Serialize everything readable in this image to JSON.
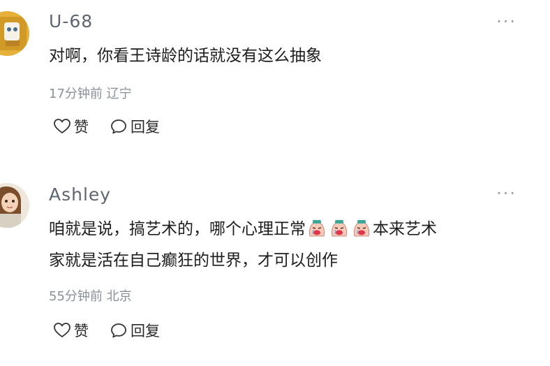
{
  "comments": [
    {
      "username": "U-68",
      "text": "对啊，你看王诗龄的话就没有这么抽象",
      "time": "17分钟前",
      "location": "辽宁",
      "like_label": "赞",
      "reply_label": "回复",
      "more": "···"
    },
    {
      "username": "Ashley",
      "text_part1": "咱就是说，搞艺术的，哪个心理正常",
      "text_part2": "本来艺术",
      "text_line2": "家就是活在自己癫狂的世界，才可以创作",
      "time": "55分钟前",
      "location": "北京",
      "like_label": "赞",
      "reply_label": "回复",
      "more": "···"
    }
  ],
  "icons": [
    "heart-icon",
    "comment-bubble-icon",
    "more-dots-icon",
    "crying-face-emoji"
  ],
  "colors": {
    "username": "#5f6570",
    "meta": "#8a8f97",
    "text": "#1d1d1f"
  }
}
